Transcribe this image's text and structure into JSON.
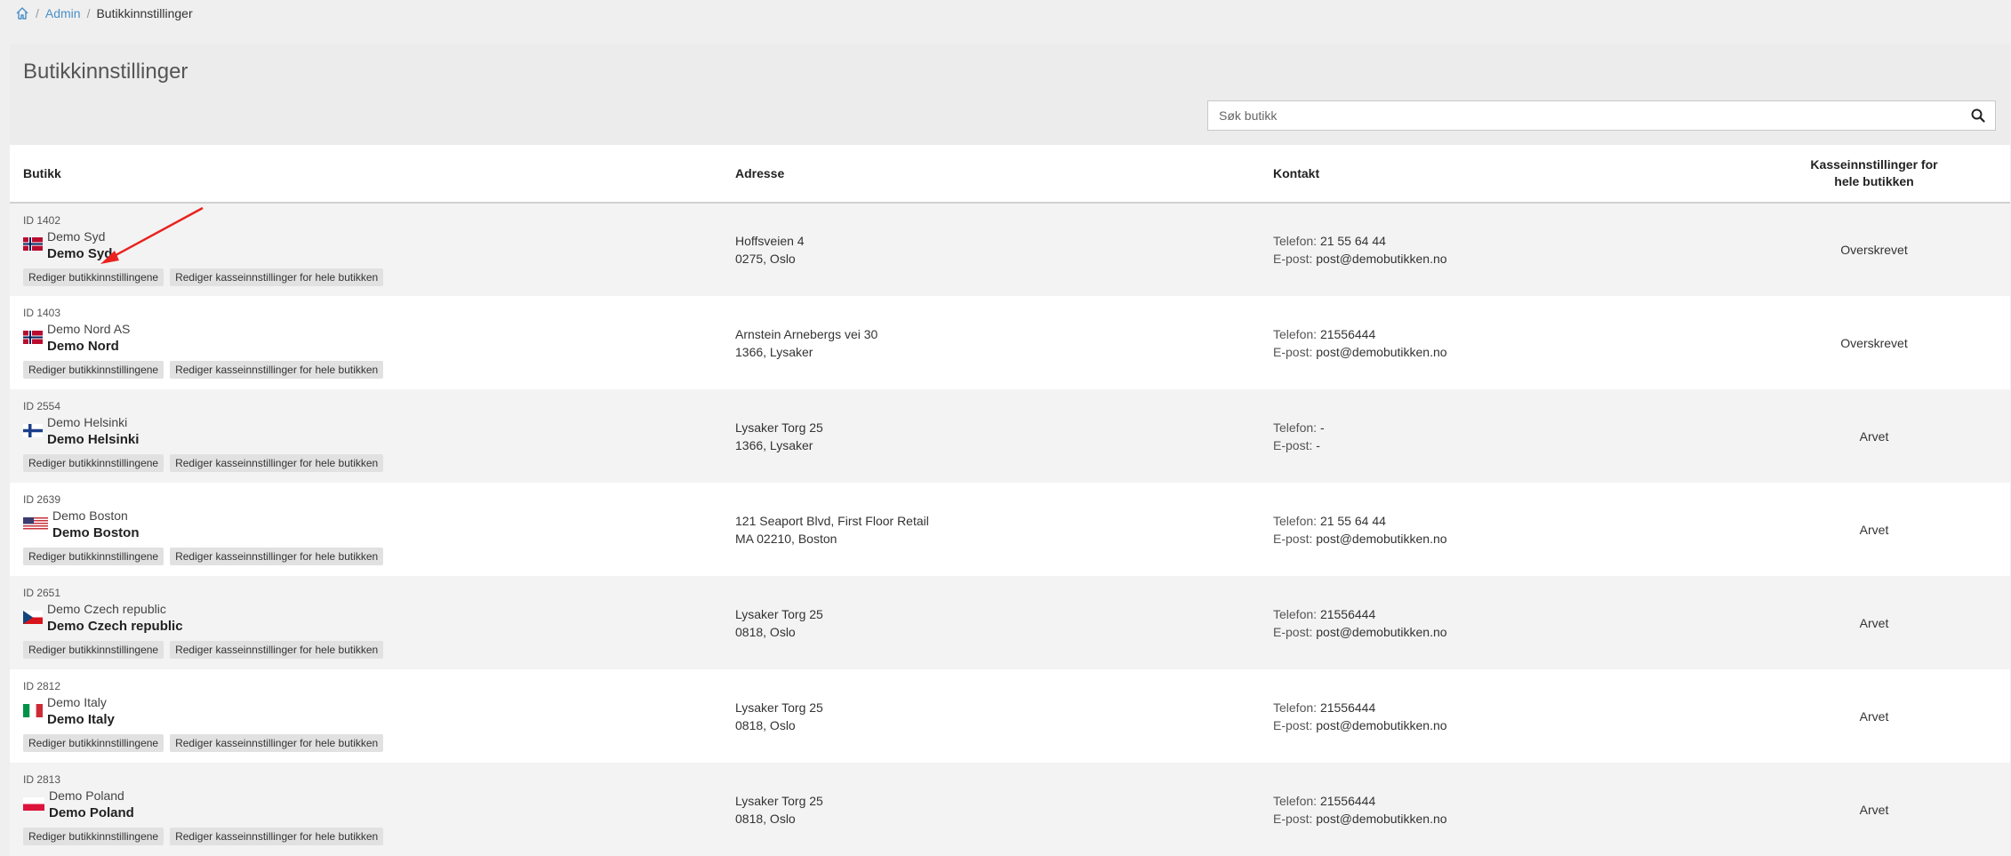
{
  "breadcrumb": {
    "home_icon": "home-icon",
    "separator": "/",
    "admin": "Admin",
    "current": "Butikkinnstillinger"
  },
  "page": {
    "title": "Butikkinnstillinger",
    "search_placeholder": "Søk butikk",
    "search_value": ""
  },
  "table": {
    "headers": {
      "store": "Butikk",
      "address": "Adresse",
      "contact": "Kontakt",
      "pos_settings": "Kasseinnstillinger for hele butikken"
    },
    "labels": {
      "phone": "Telefon:",
      "email": "E-post:",
      "edit_store": "Rediger butikkinnstillingene",
      "edit_pos": "Rediger kasseinnstillinger for hele butikken"
    },
    "rows": [
      {
        "id": "ID 1402",
        "flag": "norway",
        "name": "Demo Syd",
        "display_name": "Demo Syd",
        "street": "Hoffsveien 4",
        "city": "0275, Oslo",
        "phone": "21 55 64 44",
        "email": "post@demobutikken.no",
        "status": "Overskrevet"
      },
      {
        "id": "ID 1403",
        "flag": "norway",
        "name": "Demo Nord AS",
        "display_name": "Demo Nord",
        "street": "Arnstein Arnebergs vei 30",
        "city": "1366, Lysaker",
        "phone": "21556444",
        "email": "post@demobutikken.no",
        "status": "Overskrevet"
      },
      {
        "id": "ID 2554",
        "flag": "finland",
        "name": "Demo Helsinki",
        "display_name": "Demo Helsinki",
        "street": "Lysaker Torg 25",
        "city": "1366, Lysaker",
        "phone": "-",
        "email": "-",
        "status": "Arvet"
      },
      {
        "id": "ID 2639",
        "flag": "usa",
        "name": "Demo Boston",
        "display_name": "Demo Boston",
        "street": "121 Seaport Blvd, First Floor Retail",
        "city": "MA 02210, Boston",
        "phone": "21 55 64 44",
        "email": "post@demobutikken.no",
        "status": "Arvet"
      },
      {
        "id": "ID 2651",
        "flag": "czech",
        "name": "Demo Czech republic",
        "display_name": "Demo Czech republic",
        "street": "Lysaker Torg 25",
        "city": "0818, Oslo",
        "phone": "21556444",
        "email": "post@demobutikken.no",
        "status": "Arvet"
      },
      {
        "id": "ID 2812",
        "flag": "italy",
        "name": "Demo Italy",
        "display_name": "Demo Italy",
        "street": "Lysaker Torg 25",
        "city": "0818, Oslo",
        "phone": "21556444",
        "email": "post@demobutikken.no",
        "status": "Arvet"
      },
      {
        "id": "ID 2813",
        "flag": "poland",
        "name": "Demo Poland",
        "display_name": "Demo Poland",
        "street": "Lysaker Torg 25",
        "city": "0818, Oslo",
        "phone": "21556444",
        "email": "post@demobutikken.no",
        "status": "Arvet"
      }
    ]
  },
  "colors": {
    "link": "#4a90c8",
    "annotation_arrow": "#e8231f"
  }
}
